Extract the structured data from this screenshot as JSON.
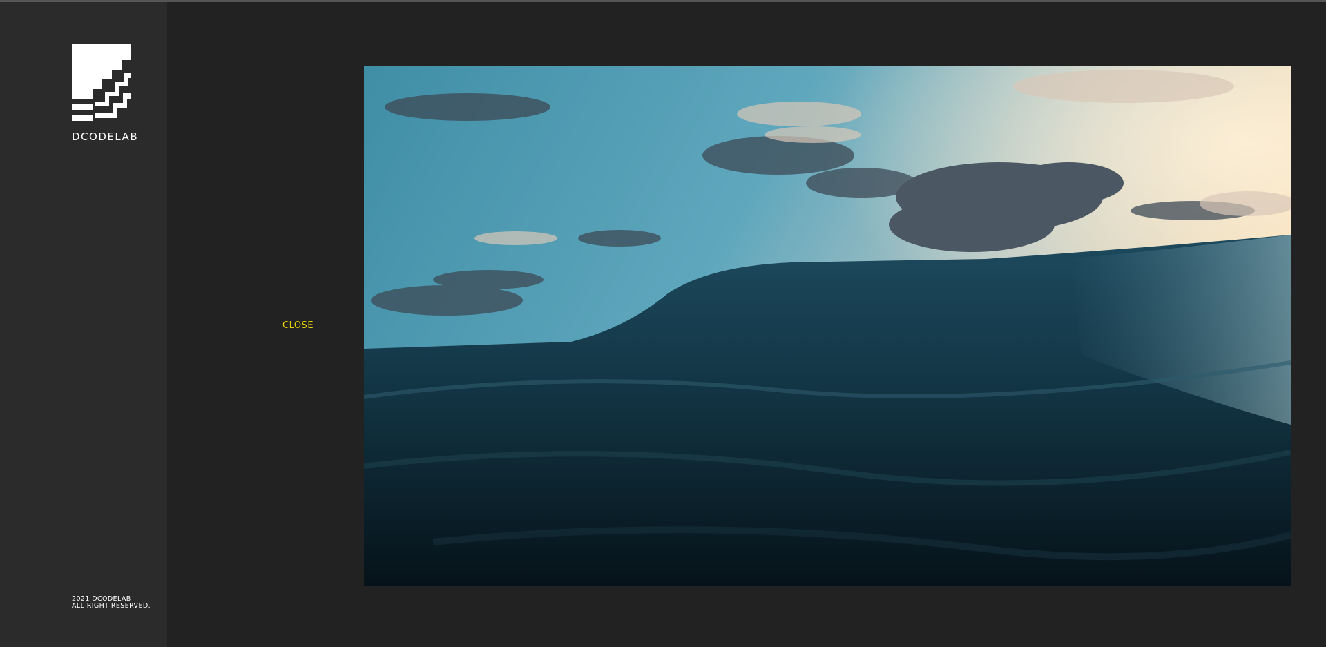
{
  "sidebar": {
    "brand": "DCODELAB",
    "copyright_line1": "2021 DCODELAB",
    "copyright_line2": "ALL RIGHT RESERVED."
  },
  "modal": {
    "close_label": "CLOSE"
  },
  "colors": {
    "background": "#222222",
    "sidebar": "#2b2b2b",
    "accent_close": "#e6d100",
    "text": "#ffffff"
  },
  "icons": {
    "logo": "stairs-logo-icon"
  }
}
